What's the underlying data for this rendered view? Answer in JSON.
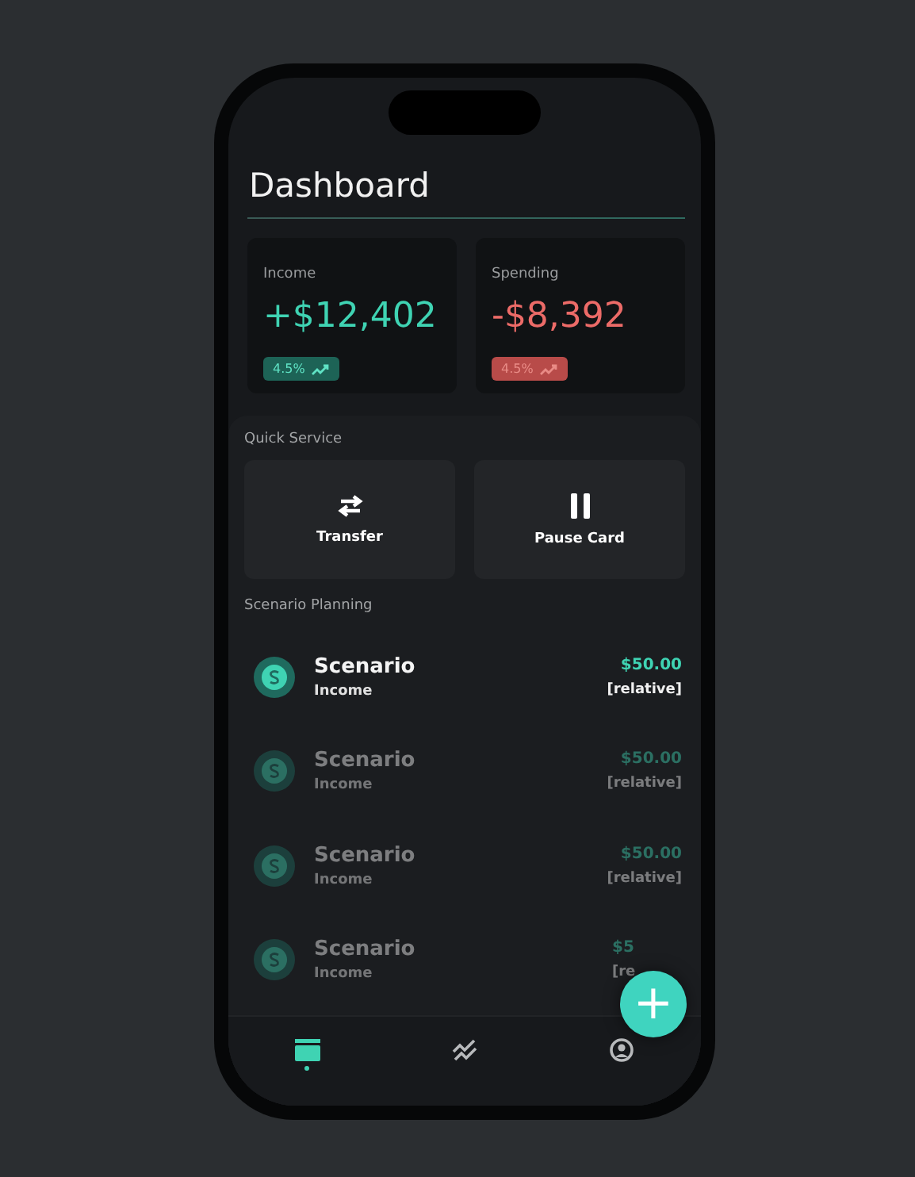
{
  "title": "Dashboard",
  "summary_cards": [
    {
      "kind": "income",
      "label": "Income",
      "amount": "+$12,402",
      "change": "4.5%"
    },
    {
      "kind": "spending",
      "label": "Spending",
      "amount": "-$8,392",
      "change": "4.5%"
    }
  ],
  "quick_service": {
    "heading": "Quick Service",
    "actions": [
      {
        "kind": "transfer",
        "label": "Transfer"
      },
      {
        "kind": "pause",
        "label": "Pause Card"
      }
    ]
  },
  "scenario_planning": {
    "heading": "Scenario Planning",
    "items": [
      {
        "title": "Scenario",
        "subtitle": "Income",
        "amount": "$50.00",
        "note": "[relative]",
        "faded": false
      },
      {
        "title": "Scenario",
        "subtitle": "Income",
        "amount": "$50.00",
        "note": "[relative]",
        "faded": true
      },
      {
        "title": "Scenario",
        "subtitle": "Income",
        "amount": "$50.00",
        "note": "[relative]",
        "faded": true
      },
      {
        "title": "Scenario",
        "subtitle": "Income",
        "amount": "$5",
        "note": "[re",
        "faded": true
      }
    ]
  },
  "fab": {
    "label": "+"
  },
  "bottom_nav": [
    {
      "kind": "card",
      "selected": true
    },
    {
      "kind": "chart",
      "selected": false
    },
    {
      "kind": "profile",
      "selected": false
    }
  ]
}
